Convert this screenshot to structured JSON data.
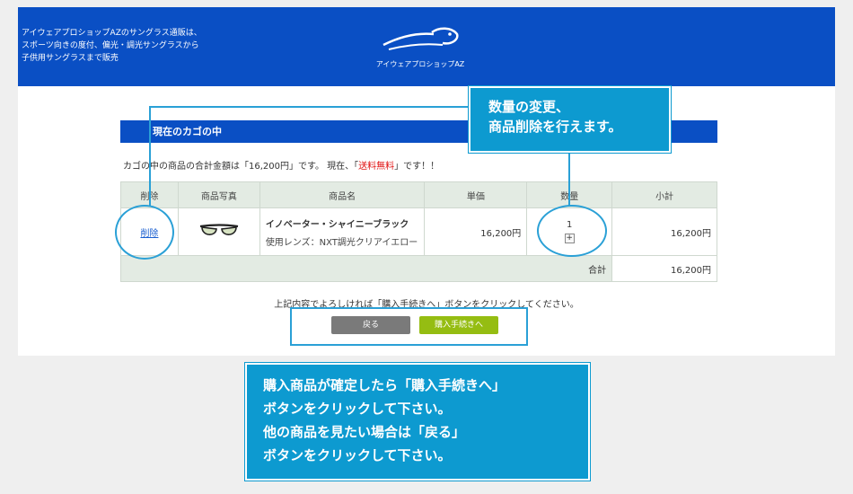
{
  "header": {
    "tagline": [
      "アイウェアプロショップAZのサングラス通販は、",
      "スポーツ向きの度付、偏光・調光サングラスから",
      "子供用サングラスまで販売"
    ],
    "logo_name": "アイウェアプロショップAZ",
    "colors": {
      "header_bg": "#0a4fc4",
      "callout_bg": "#0d9ad0"
    }
  },
  "cart": {
    "section_title": "現在のカゴの中",
    "summary_prefix": "カゴの中の商品の合計金額は「16,200円」です。 現在、「",
    "summary_red": "送料無料",
    "summary_suffix": "」です！！",
    "columns": [
      "削除",
      "商品写真",
      "商品名",
      "単価",
      "数量",
      "小計"
    ],
    "item": {
      "delete_label": "削除",
      "image_icon": "sunglasses-icon",
      "name": "イノベーター・シャイニーブラック",
      "lens": "使用レンズ：NXT調光クリアイエロー",
      "unit_price": "16,200円",
      "quantity": "1",
      "quantity_plus": "+",
      "subtotal": "16,200円"
    },
    "total_label": "合計",
    "total_value": "16,200円"
  },
  "footer": {
    "note": "上記内容でよろしければ「購入手続きへ」ボタンをクリックしてください。",
    "back_button": "戻る",
    "checkout_button": "購入手続きへ"
  },
  "callouts": {
    "top": [
      "数量の変更、",
      "商品削除を行えます。"
    ],
    "bottom": [
      "購入商品が確定したら「購入手続きへ」",
      "ボタンをクリックして下さい。",
      "他の商品を見たい場合は「戻る」",
      "ボタンをクリックして下さい。"
    ]
  }
}
